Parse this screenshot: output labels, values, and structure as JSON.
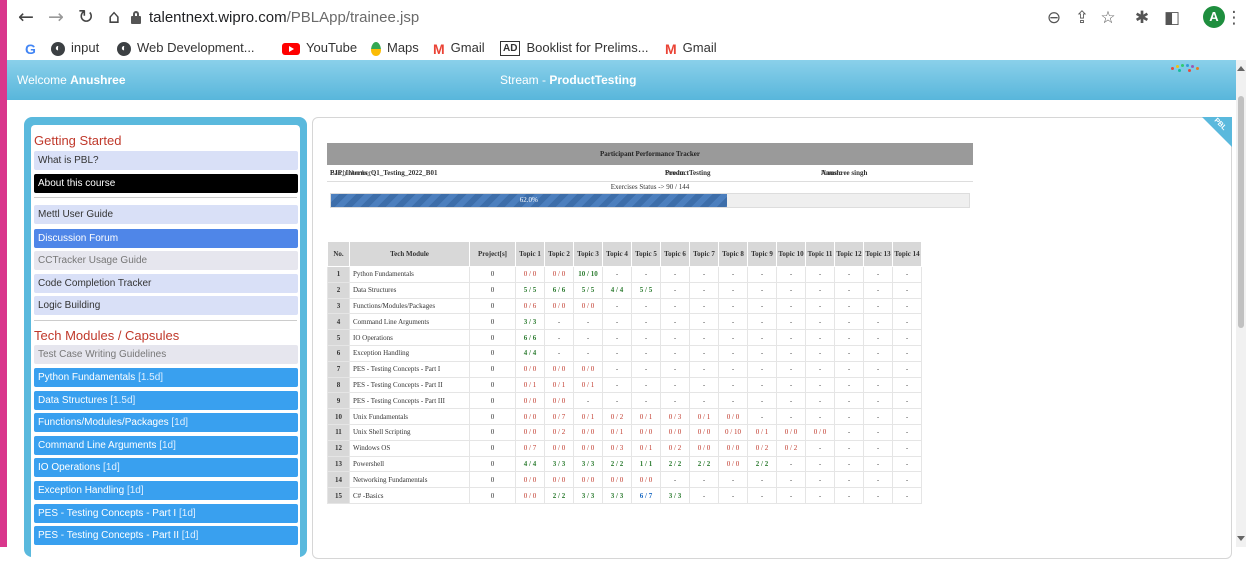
{
  "browser": {
    "url_host": "talentnext.wipro.com",
    "url_path": "/PBLApp/trainee.jsp",
    "profile_initial": "A",
    "bookmarks": [
      {
        "label": "",
        "icon": "google-icon"
      },
      {
        "label": "input",
        "icon": "globe-icon"
      },
      {
        "label": "Web Development...",
        "icon": "globe-icon"
      },
      {
        "label": "YouTube",
        "icon": "youtube-icon"
      },
      {
        "label": "Maps",
        "icon": "maps-icon"
      },
      {
        "label": "Gmail",
        "icon": "gmail-icon"
      },
      {
        "label": "Booklist for Prelims...",
        "icon": "ad-icon"
      },
      {
        "label": "Gmail",
        "icon": "gmail-icon"
      }
    ]
  },
  "header": {
    "welcome_prefix": "Welcome",
    "user": "Anushree",
    "stream_prefix": "Stream -",
    "stream": "ProductTesting"
  },
  "sidebar": {
    "getting_started_title": "Getting Started",
    "items": [
      {
        "label": "What is PBL?",
        "style": "light"
      },
      {
        "label": "About this course",
        "style": "black"
      },
      {
        "label": "Mettl User Guide",
        "style": "light"
      },
      {
        "label": "Discussion Forum",
        "style": "blue"
      },
      {
        "label": "CCTracker Usage Guide",
        "style": "gray"
      },
      {
        "label": "Code Completion Tracker",
        "style": "light"
      },
      {
        "label": "Logic Building",
        "style": "light"
      }
    ],
    "tech_title": "Tech Modules / Capsules",
    "modules": [
      {
        "label": "Test Case Writing Guidelines",
        "dur": "",
        "style": "gray"
      },
      {
        "label": "Python Fundamentals",
        "dur": "[1.5d]",
        "style": "mod"
      },
      {
        "label": "Data Structures",
        "dur": "[1.5d]",
        "style": "mod"
      },
      {
        "label": "Functions/Modules/Packages",
        "dur": "[1d]",
        "style": "mod"
      },
      {
        "label": "Command Line Arguments",
        "dur": "[1d]",
        "style": "mod"
      },
      {
        "label": "IO Operations",
        "dur": "[1d]",
        "style": "mod"
      },
      {
        "label": "Exception Handling",
        "dur": "[1d]",
        "style": "mod"
      },
      {
        "label": "PES - Testing Concepts - Part I",
        "dur": "[1d]",
        "style": "mod"
      },
      {
        "label": "PES - Testing Concepts - Part II",
        "dur": "[1d]",
        "style": "mod"
      }
    ]
  },
  "panel": {
    "corner_label": "PBL",
    "tracker_title": "Participant Performance Tracker",
    "batch_label": "Batch Number : ",
    "batch": "PJP_Interns_Q1_Testing_2022_B01",
    "stream_label": "Stream : ",
    "stream": "ProductTesting",
    "name_label": "Name : ",
    "name": "Anushree singh",
    "exercise_status": "Exercises Status -> 90 / 144",
    "progress_text": "62.0%",
    "progress": 0.62
  },
  "table": {
    "headers": [
      "No.",
      "Tech Module",
      "Project[s]",
      "Topic 1",
      "Topic 2",
      "Topic 3",
      "Topic 4",
      "Topic 5",
      "Topic 6",
      "Topic 7",
      "Topic 8",
      "Topic 9",
      "Topic 10",
      "Topic 11",
      "Topic 12",
      "Topic 13",
      "Topic 14"
    ],
    "rows": [
      {
        "no": "1",
        "module": "Python Fundamentals",
        "project": "0",
        "topics": [
          "0 / 0",
          "0 / 0",
          "10 / 10",
          "-",
          "-",
          "-",
          "-",
          "-",
          "-",
          "-",
          "-",
          "-",
          "-",
          "-"
        ]
      },
      {
        "no": "2",
        "module": "Data Structures",
        "project": "0",
        "topics": [
          "5 / 5",
          "6 / 6",
          "5 / 5",
          "4 / 4",
          "5 / 5",
          "-",
          "-",
          "-",
          "-",
          "-",
          "-",
          "-",
          "-",
          "-"
        ]
      },
      {
        "no": "3",
        "module": "Functions/Modules/Packages",
        "project": "0",
        "topics": [
          "0 / 6",
          "0 / 0",
          "0 / 0",
          "-",
          "-",
          "-",
          "-",
          "-",
          "-",
          "-",
          "-",
          "-",
          "-",
          "-"
        ]
      },
      {
        "no": "4",
        "module": "Command Line Arguments",
        "project": "0",
        "topics": [
          "3 / 3",
          "-",
          "-",
          "-",
          "-",
          "-",
          "-",
          "-",
          "-",
          "-",
          "-",
          "-",
          "-",
          "-"
        ]
      },
      {
        "no": "5",
        "module": "IO Operations",
        "project": "0",
        "topics": [
          "6 / 6",
          "-",
          "-",
          "-",
          "-",
          "-",
          "-",
          "-",
          "-",
          "-",
          "-",
          "-",
          "-",
          "-"
        ]
      },
      {
        "no": "6",
        "module": "Exception Handling",
        "project": "0",
        "topics": [
          "4 / 4",
          "-",
          "-",
          "-",
          "-",
          "-",
          "-",
          "-",
          "-",
          "-",
          "-",
          "-",
          "-",
          "-"
        ]
      },
      {
        "no": "7",
        "module": "PES - Testing Concepts - Part I",
        "project": "0",
        "topics": [
          "0 / 0",
          "0 / 0",
          "0 / 0",
          "-",
          "-",
          "-",
          "-",
          "-",
          "-",
          "-",
          "-",
          "-",
          "-",
          "-"
        ]
      },
      {
        "no": "8",
        "module": "PES - Testing Concepts - Part II",
        "project": "0",
        "topics": [
          "0 / 1",
          "0 / 1",
          "0 / 1",
          "-",
          "-",
          "-",
          "-",
          "-",
          "-",
          "-",
          "-",
          "-",
          "-",
          "-"
        ]
      },
      {
        "no": "9",
        "module": "PES - Testing Concepts - Part III",
        "project": "0",
        "topics": [
          "0 / 0",
          "0 / 0",
          "-",
          "-",
          "-",
          "-",
          "-",
          "-",
          "-",
          "-",
          "-",
          "-",
          "-",
          "-"
        ]
      },
      {
        "no": "10",
        "module": "Unix Fundamentals",
        "project": "0",
        "topics": [
          "0 / 0",
          "0 / 7",
          "0 / 1",
          "0 / 2",
          "0 / 1",
          "0 / 3",
          "0 / 1",
          "0 / 0",
          "-",
          "-",
          "-",
          "-",
          "-",
          "-"
        ]
      },
      {
        "no": "11",
        "module": "Unix Shell Scripting",
        "project": "0",
        "topics": [
          "0 / 0",
          "0 / 2",
          "0 / 0",
          "0 / 1",
          "0 / 0",
          "0 / 0",
          "0 / 0",
          "0 / 10",
          "0 / 1",
          "0 / 0",
          "0 / 0",
          "-",
          "-",
          "-"
        ]
      },
      {
        "no": "12",
        "module": "Windows OS",
        "project": "0",
        "topics": [
          "0 / 7",
          "0 / 0",
          "0 / 0",
          "0 / 3",
          "0 / 1",
          "0 / 2",
          "0 / 0",
          "0 / 0",
          "0 / 2",
          "0 / 2",
          "-",
          "-",
          "-",
          "-"
        ]
      },
      {
        "no": "13",
        "module": "Powershell",
        "project": "0",
        "topics": [
          "4 / 4",
          "3 / 3",
          "3 / 3",
          "2 / 2",
          "1 / 1",
          "2 / 2",
          "2 / 2",
          "0 / 0",
          "2 / 2",
          "-",
          "-",
          "-",
          "-",
          "-"
        ]
      },
      {
        "no": "14",
        "module": "Networking Fundamentals",
        "project": "0",
        "topics": [
          "0 / 0",
          "0 / 0",
          "0 / 0",
          "0 / 0",
          "0 / 0",
          "-",
          "-",
          "-",
          "-",
          "-",
          "-",
          "-",
          "-",
          "-"
        ]
      },
      {
        "no": "15",
        "module": "C# -Basics",
        "project": "0",
        "topics": [
          "0 / 0",
          "2 / 2",
          "3 / 3",
          "3 / 3",
          "6 / 7",
          "3 / 3",
          "-",
          "-",
          "-",
          "-",
          "-",
          "-",
          "-",
          "-"
        ]
      }
    ]
  }
}
